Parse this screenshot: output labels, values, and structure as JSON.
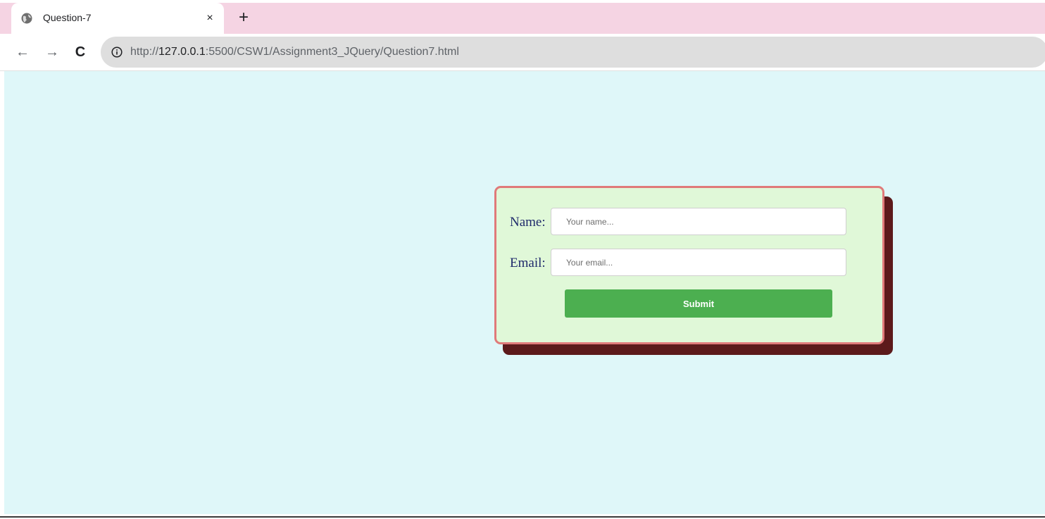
{
  "browser": {
    "tab": {
      "title": "Question-7",
      "close_glyph": "×",
      "favicon": "globe-icon"
    },
    "new_tab_glyph": "+",
    "nav": {
      "back_glyph": "←",
      "forward_glyph": "→",
      "reload_glyph": "C"
    },
    "omnibox": {
      "info_icon": "info-icon",
      "url_prefix": "http://",
      "url_host": "127.0.0.1",
      "url_rest": ":5500/CSW1/Assignment3_JQuery/Question7.html"
    }
  },
  "page": {
    "background": "#dff7f9",
    "form": {
      "name_label": "Name:",
      "name_placeholder": "Your name...",
      "email_label": "Email:",
      "email_placeholder": "Your email...",
      "submit_label": "Submit"
    },
    "colors": {
      "card_bg": "#e0f8d8",
      "card_border": "#e07a7a",
      "card_shadow": "#5c1a1b",
      "submit_bg": "#4caf50",
      "label_color": "#1f2a6b",
      "tabstrip_bg": "#f5d4e3"
    }
  }
}
